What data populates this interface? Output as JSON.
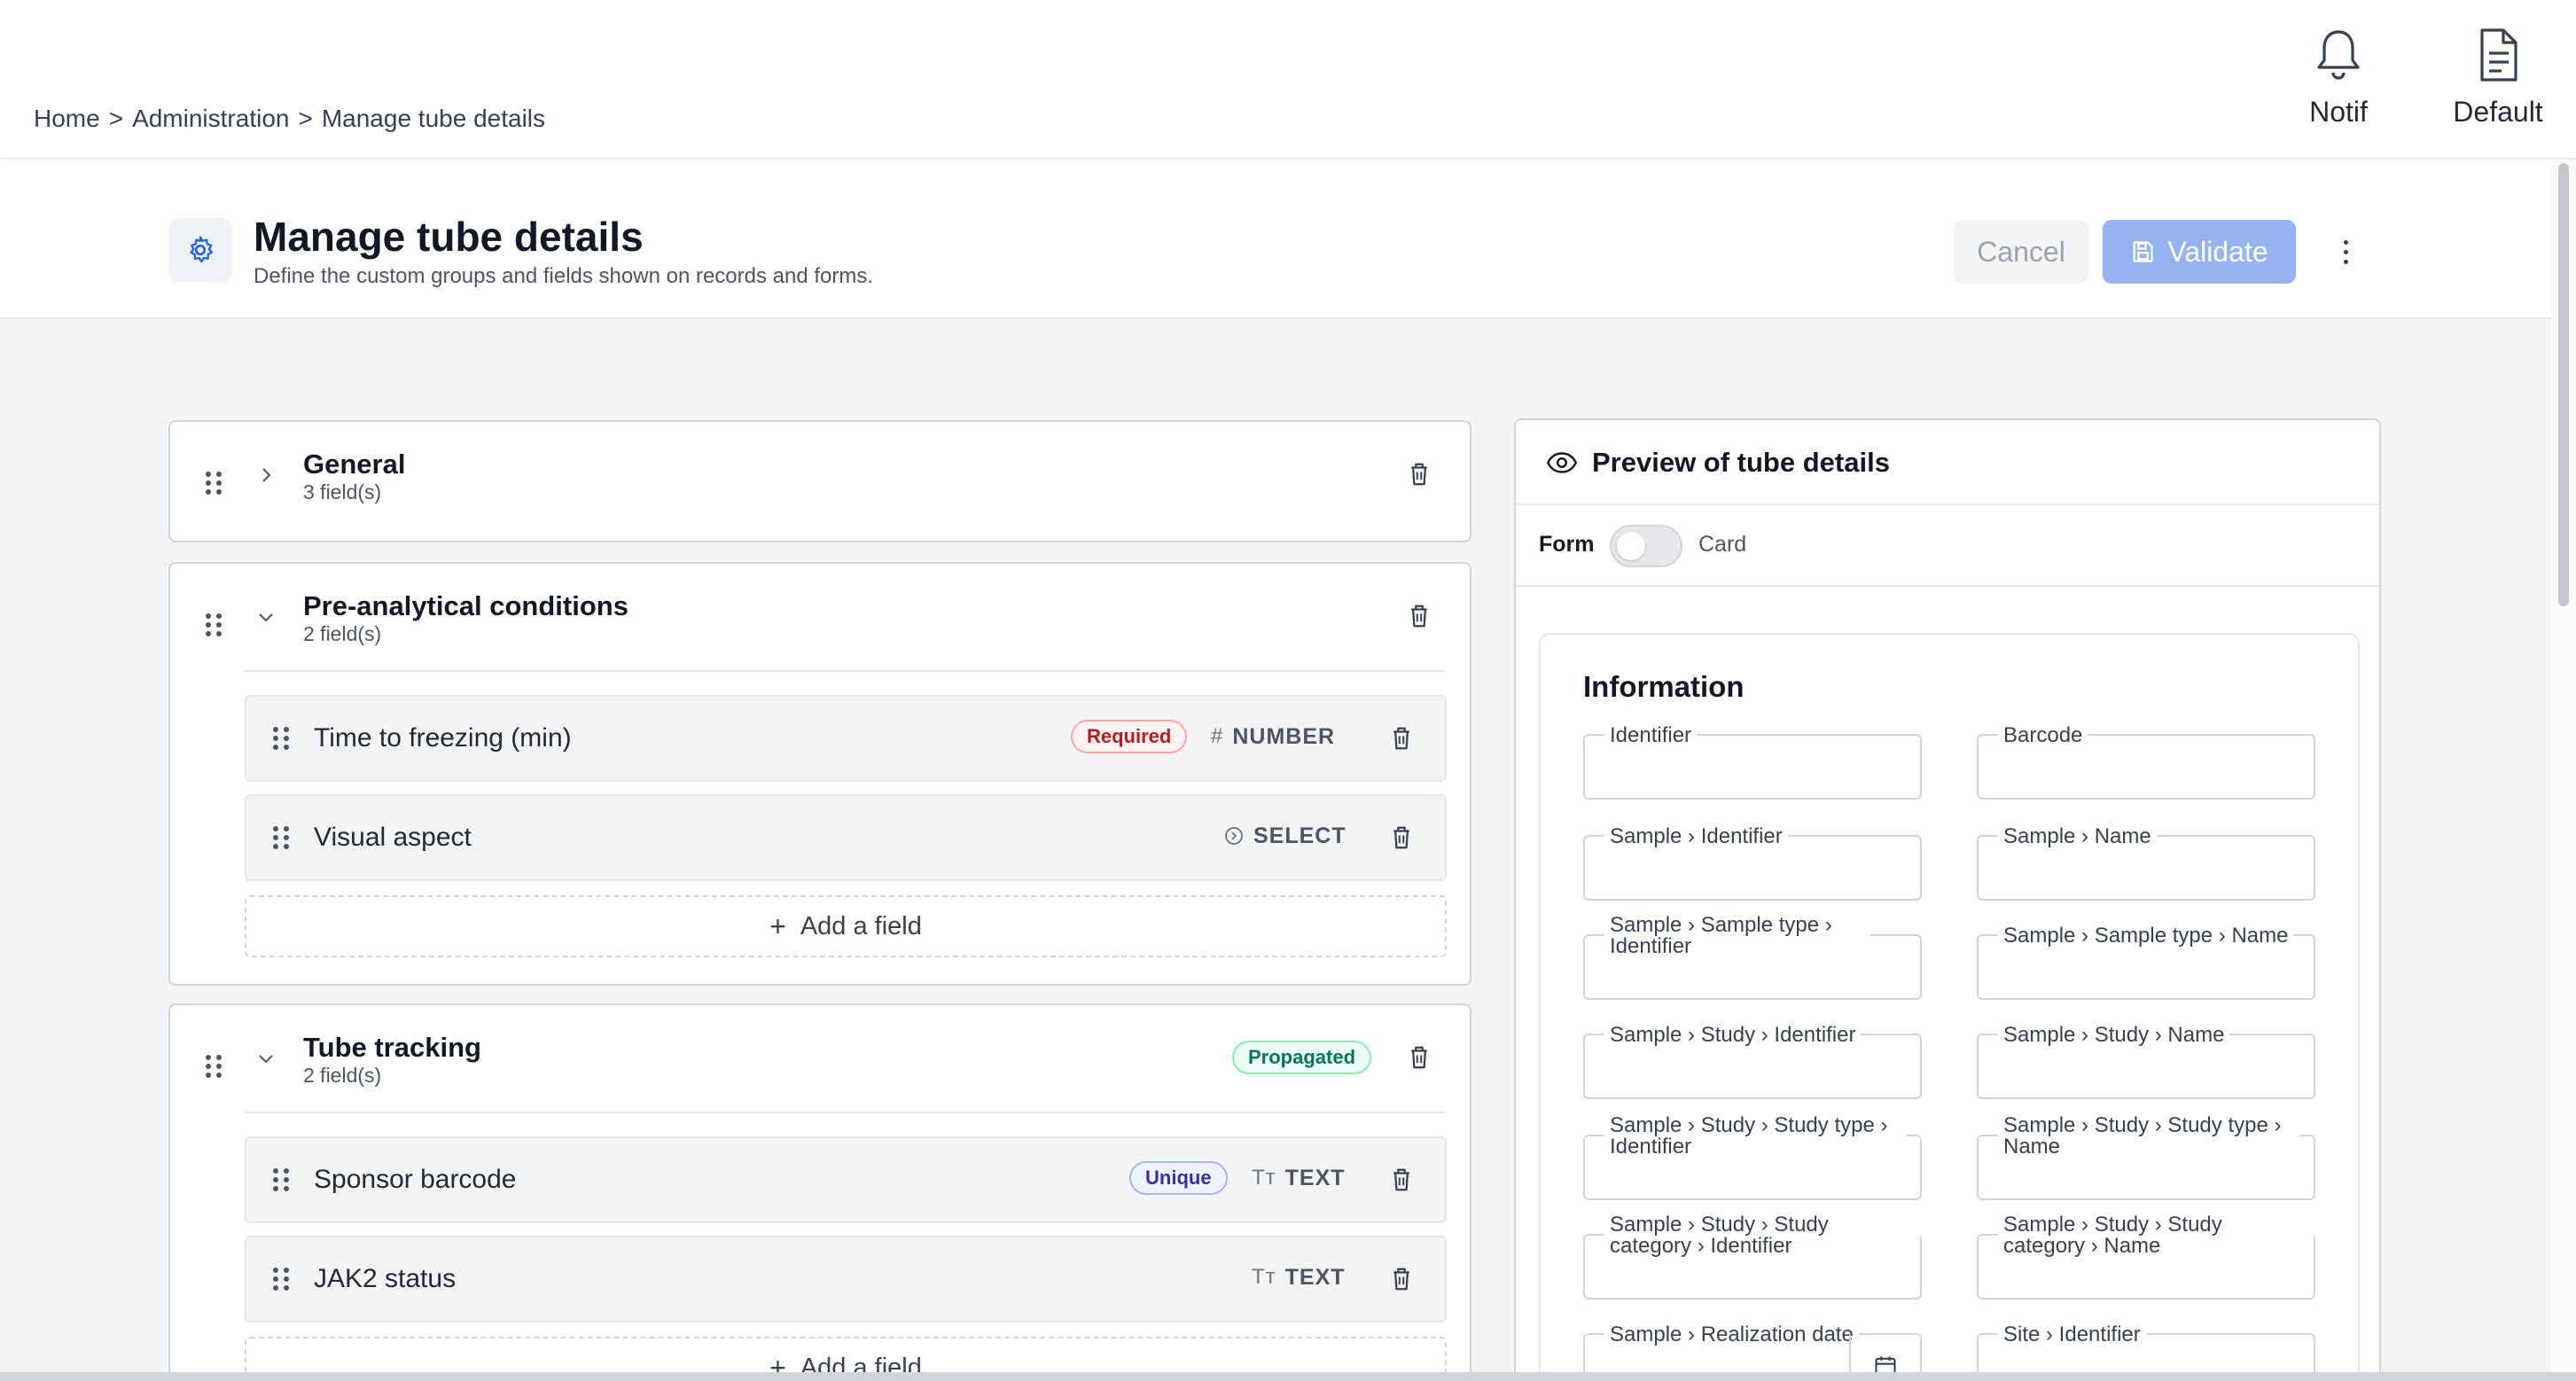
{
  "breadcrumb": {
    "home": "Home",
    "sep": ">",
    "admin": "Administration",
    "current": "Manage tube details"
  },
  "top_actions": {
    "notif": "Notif",
    "default": "Default"
  },
  "header": {
    "title": "Manage tube details",
    "subtitle": "Define the custom groups and fields shown on records and forms.",
    "cancel": "Cancel",
    "validate": "Validate"
  },
  "groups": [
    {
      "title": "General",
      "count": "3 field(s)",
      "expanded": false
    },
    {
      "title": "Pre-analytical conditions",
      "count": "2 field(s)",
      "expanded": true,
      "fields": [
        {
          "label": "Time to freezing (min)",
          "badge": "Required",
          "type": "NUMBER",
          "type_icon": "hash-icon"
        },
        {
          "label": "Visual aspect",
          "type": "SELECT",
          "type_icon": "select-icon"
        }
      ],
      "add": "Add a field"
    },
    {
      "title": "Tube tracking",
      "count": "2 field(s)",
      "badge": "Propagated",
      "expanded": true,
      "fields": [
        {
          "label": "Sponsor barcode",
          "badge": "Unique",
          "type": "TEXT",
          "type_icon": "text-icon"
        },
        {
          "label": "JAK2 status",
          "type": "TEXT",
          "type_icon": "text-icon"
        }
      ],
      "add": "Add a field"
    }
  ],
  "preview": {
    "title": "Preview of tube details",
    "toggle_form": "Form",
    "toggle_card": "Card",
    "toggle_on": false,
    "section_title": "Information",
    "fields": [
      {
        "label": "Identifier"
      },
      {
        "label": "Barcode"
      },
      {
        "label": "Sample › Identifier"
      },
      {
        "label": "Sample › Name"
      },
      {
        "label": "Sample › Sample type › Identifier"
      },
      {
        "label": "Sample › Sample type › Name"
      },
      {
        "label": "Sample › Study › Identifier"
      },
      {
        "label": "Sample › Study › Name"
      },
      {
        "label": "Sample › Study › Study type › Identifier"
      },
      {
        "label": "Sample › Study › Study type › Name"
      },
      {
        "label": "Sample › Study › Study category › Identifier"
      },
      {
        "label": "Sample › Study › Study category › Name"
      },
      {
        "label": "Sample › Realization date"
      },
      {
        "label": "Site › Identifier"
      }
    ]
  },
  "colors": {
    "accent": "#93b4f0",
    "required": "#b91c1c",
    "unique": "#3730a3",
    "propagated": "#047857"
  }
}
